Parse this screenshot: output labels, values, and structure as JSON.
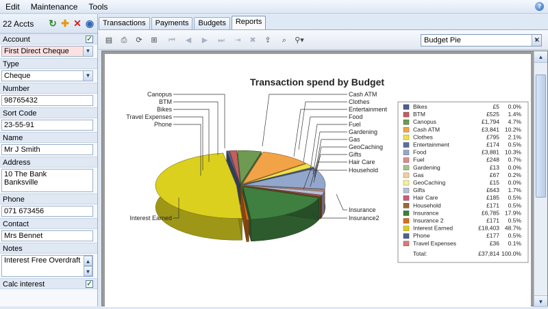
{
  "menu": {
    "items": [
      "Edit",
      "Maintenance",
      "Tools"
    ]
  },
  "left": {
    "count": "22 Accts",
    "fields": [
      {
        "key": "account",
        "label": "Account",
        "value": "First Direct Cheque",
        "style": "dropdown-pink",
        "checkbox": true
      },
      {
        "key": "type",
        "label": "Type",
        "value": "Cheque",
        "style": "dropdown"
      },
      {
        "key": "number",
        "label": "Number",
        "value": "98765432",
        "style": "text"
      },
      {
        "key": "sort",
        "label": "Sort Code",
        "value": "23-55-91",
        "style": "text"
      },
      {
        "key": "name",
        "label": "Name",
        "value": "Mr J Smith",
        "style": "text"
      },
      {
        "key": "address",
        "label": "Address",
        "value": "10 The Bank\nBanksville",
        "style": "tall"
      },
      {
        "key": "phone",
        "label": "Phone",
        "value": "071 673456",
        "style": "text"
      },
      {
        "key": "contact",
        "label": "Contact",
        "value": "Mrs Bennet",
        "style": "text"
      },
      {
        "key": "notes",
        "label": "Notes",
        "value": "Interest Free Overdraft",
        "style": "notes"
      },
      {
        "key": "calc",
        "label": "Calc interest",
        "value": "",
        "style": "labelonly",
        "checkbox": true
      }
    ]
  },
  "tabs": [
    "Transactions",
    "Payments",
    "Budgets",
    "Reports"
  ],
  "active_tab": "Reports",
  "report_select": "Budget Pie",
  "colors": {
    "accent": "#2f66b3",
    "panel": "#dfe9f5"
  },
  "chart_data": {
    "type": "pie",
    "title": "Transaction spend by Budget",
    "total_label": "Total:",
    "total_amount": "£37,814",
    "total_percent": "100.0%",
    "series": [
      {
        "name": "Bikes",
        "amount": "£5",
        "percent": "0.0%",
        "value": 5,
        "color": "#4a5f8c"
      },
      {
        "name": "BTM",
        "amount": "£525",
        "percent": "1.4%",
        "value": 525,
        "color": "#c1605e"
      },
      {
        "name": "Canopus",
        "amount": "£1,794",
        "percent": "4.7%",
        "value": 1794,
        "color": "#6f9a52"
      },
      {
        "name": "Cash ATM",
        "amount": "£3,841",
        "percent": "10.2%",
        "value": 3841,
        "color": "#f3a347"
      },
      {
        "name": "Clothes",
        "amount": "£795",
        "percent": "2.1%",
        "value": 795,
        "color": "#efe04a"
      },
      {
        "name": "Entertainment",
        "amount": "£174",
        "percent": "0.5%",
        "value": 174,
        "color": "#5a6f9e"
      },
      {
        "name": "Food",
        "amount": "£3,881",
        "percent": "10.3%",
        "value": 3881,
        "color": "#93a7cc"
      },
      {
        "name": "Fuel",
        "amount": "£248",
        "percent": "0.7%",
        "value": 248,
        "color": "#d98d8d"
      },
      {
        "name": "Gardening",
        "amount": "£13",
        "percent": "0.0%",
        "value": 13,
        "color": "#a9c28a"
      },
      {
        "name": "Gas",
        "amount": "£67",
        "percent": "0.2%",
        "value": 67,
        "color": "#f4cf9a"
      },
      {
        "name": "GeoCaching",
        "amount": "£15",
        "percent": "0.0%",
        "value": 15,
        "color": "#f6ef9a"
      },
      {
        "name": "Gifts",
        "amount": "£643",
        "percent": "1.7%",
        "value": 643,
        "color": "#b6c0d8"
      },
      {
        "name": "Hair Care",
        "amount": "£185",
        "percent": "0.5%",
        "value": 185,
        "color": "#c95f74"
      },
      {
        "name": "Household",
        "amount": "£171",
        "percent": "0.5%",
        "value": 171,
        "color": "#9a6a36"
      },
      {
        "name": "Insurance",
        "amount": "£6,785",
        "percent": "17.9%",
        "value": 6785,
        "color": "#3f7f3f"
      },
      {
        "name": "Insurance 2",
        "amount": "£171",
        "percent": "0.5%",
        "value": 171,
        "color": "#d86f1d"
      },
      {
        "name": "Interest Earned",
        "amount": "£18,403",
        "percent": "48.7%",
        "value": 18403,
        "color": "#dcd01e"
      },
      {
        "name": "Phone",
        "amount": "£177",
        "percent": "0.5%",
        "value": 177,
        "color": "#4f628f"
      },
      {
        "name": "Travel Expenses",
        "amount": "£36",
        "percent": "0.1%",
        "value": 36,
        "color": "#d97a7a"
      }
    ],
    "callout_labels": [
      {
        "text": "Canopus",
        "side": "left"
      },
      {
        "text": "BTM",
        "side": "left"
      },
      {
        "text": "Bikes",
        "side": "left"
      },
      {
        "text": "Travel Expenses",
        "side": "left"
      },
      {
        "text": "Phone",
        "side": "left"
      },
      {
        "text": "Interest Earned",
        "side": "left"
      },
      {
        "text": "Cash ATM",
        "side": "right"
      },
      {
        "text": "Clothes",
        "side": "right"
      },
      {
        "text": "Entertainment",
        "side": "right"
      },
      {
        "text": "Food",
        "side": "right"
      },
      {
        "text": "Fuel",
        "side": "right"
      },
      {
        "text": "Gardening",
        "side": "right"
      },
      {
        "text": "Gas",
        "side": "right"
      },
      {
        "text": "GeoCaching",
        "side": "right"
      },
      {
        "text": "Gifts",
        "side": "right"
      },
      {
        "text": "Hair Care",
        "side": "right"
      },
      {
        "text": "Household",
        "side": "right"
      },
      {
        "text": "Insurance",
        "side": "right"
      },
      {
        "text": "Insurance2",
        "side": "right"
      }
    ]
  }
}
